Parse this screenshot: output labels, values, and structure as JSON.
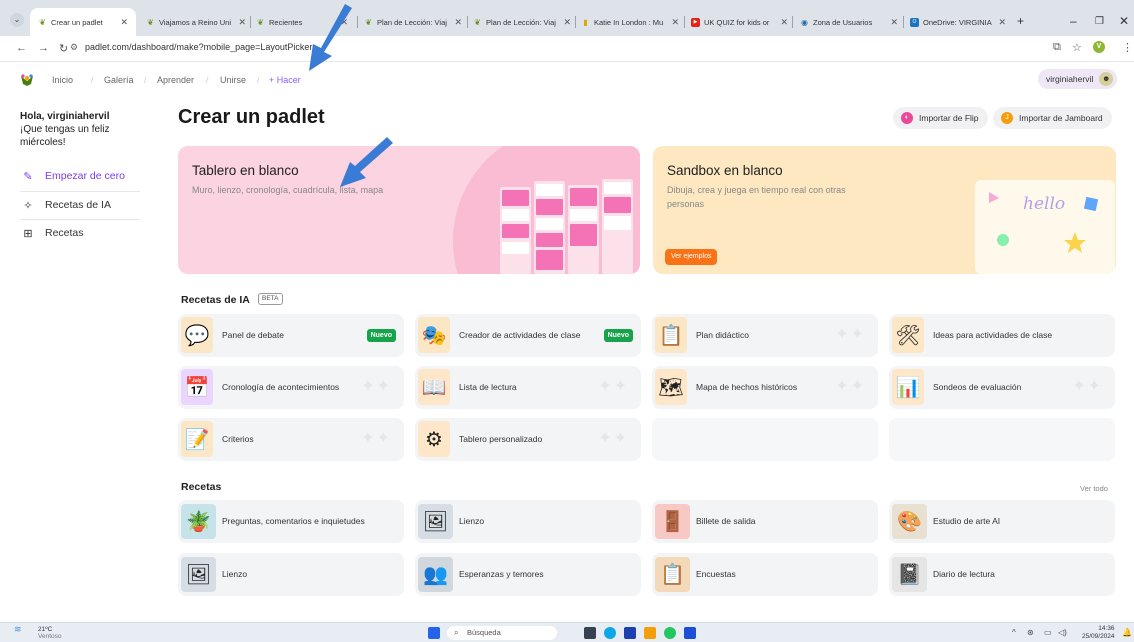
{
  "browser": {
    "tabs": [
      {
        "label": "Crear un padlet",
        "icon": "padlet-icon"
      },
      {
        "label": "Viajamos a Reino Uni",
        "icon": "padlet-icon"
      },
      {
        "label": "Recientes",
        "icon": "padlet-icon"
      },
      {
        "label": "Plan de Lección: Viaj",
        "icon": "padlet-icon"
      },
      {
        "label": "Plan de Lección: Viaj",
        "icon": "padlet-icon"
      },
      {
        "label": "Katie In London : Mu",
        "icon": "bookmark-icon"
      },
      {
        "label": "UK QUIZ for kids or",
        "icon": "youtube-icon"
      },
      {
        "label": "Zona de Usuarios",
        "icon": "globe-icon"
      },
      {
        "label": "OneDrive: VIRGINIA",
        "icon": "onedrive-icon"
      }
    ],
    "url": "padlet.com/dashboard/make?mobile_page=LayoutPicker",
    "profile_initial": "V"
  },
  "topnav": {
    "links": [
      "Inicio",
      "Galería",
      "Aprender",
      "Unirse",
      "+ Hacer"
    ],
    "user": "virginiahervil"
  },
  "sidebar": {
    "greeting_name": "Hola, virginiahervil",
    "greeting_msg": "¡Que tengas un feliz miércoles!",
    "items": [
      {
        "label": "Empezar de cero",
        "icon": "pencil-icon"
      },
      {
        "label": "Recetas de IA",
        "icon": "sparkle-icon"
      },
      {
        "label": "Recetas",
        "icon": "grid-icon"
      }
    ]
  },
  "main": {
    "title": "Crear un padlet",
    "import_flip": "Importar de Flip",
    "import_jamboard": "Importar de Jamboard",
    "hero_blank": {
      "title": "Tablero en blanco",
      "subtitle": "Muro, lienzo, cronología, cuadrícula, lista, mapa"
    },
    "hero_sandbox": {
      "title": "Sandbox en blanco",
      "subtitle": "Dibuja, crea y juega en tiempo real con otras personas",
      "button": "Ver ejemplos",
      "hello": "hello"
    },
    "ai_recipes": {
      "title": "Recetas de IA",
      "badge": "BETA",
      "new_badge": "Nuevo",
      "items": [
        {
          "label": "Panel de debate",
          "new": true,
          "icon": "debate-icon",
          "color": "#fbe7c6"
        },
        {
          "label": "Creador de actividades de clase",
          "new": true,
          "icon": "masks-icon",
          "color": "#fbe7c6"
        },
        {
          "label": "Plan didáctico",
          "new": false,
          "icon": "board-icon",
          "color": "#fbe7c6"
        },
        {
          "label": "Ideas para actividades de clase",
          "new": false,
          "icon": "tools-icon",
          "color": "#fbe7c6"
        },
        {
          "label": "Cronología de acontecimientos",
          "new": false,
          "icon": "timeline-icon",
          "color": "#e9d5ff"
        },
        {
          "label": "Lista de lectura",
          "new": false,
          "icon": "reading-icon",
          "color": "#fde7c8"
        },
        {
          "label": "Mapa de hechos históricos",
          "new": false,
          "icon": "map-icon",
          "color": "#fde7c8"
        },
        {
          "label": "Sondeos de evaluación",
          "new": false,
          "icon": "survey-icon",
          "color": "#fde7c8"
        },
        {
          "label": "Criterios",
          "new": false,
          "icon": "rubric-icon",
          "color": "#fbe7c6"
        },
        {
          "label": "Tablero personalizado",
          "new": false,
          "icon": "gears-icon",
          "color": "#fde7c8"
        }
      ]
    },
    "recipes": {
      "title": "Recetas",
      "view_all": "Ver todo",
      "items": [
        {
          "label": "Preguntas, comentarios e inquietudes",
          "icon": "plant-icon",
          "color": "#c7e3ea"
        },
        {
          "label": "Lienzo",
          "icon": "collage-icon",
          "color": "#d7dde4"
        },
        {
          "label": "Billete de salida",
          "icon": "exit-sign-icon",
          "color": "#f8c9c4"
        },
        {
          "label": "Estudio de arte AI",
          "icon": "artist-icon",
          "color": "#e8e0d0"
        },
        {
          "label": "Lienzo",
          "icon": "collage-icon",
          "color": "#d7dde4"
        },
        {
          "label": "Esperanzas y temores",
          "icon": "crowd-icon",
          "color": "#d0d8de"
        },
        {
          "label": "Encuestas",
          "icon": "clipboard-icon",
          "color": "#f3d9b8"
        },
        {
          "label": "Diario de lectura",
          "icon": "reader-icon",
          "color": "#e5e5e5"
        }
      ]
    }
  },
  "taskbar": {
    "temp": "21ºC",
    "weather": "Ventoso",
    "search": "Búsqueda",
    "time": "14:36",
    "date": "25/09/2024"
  }
}
